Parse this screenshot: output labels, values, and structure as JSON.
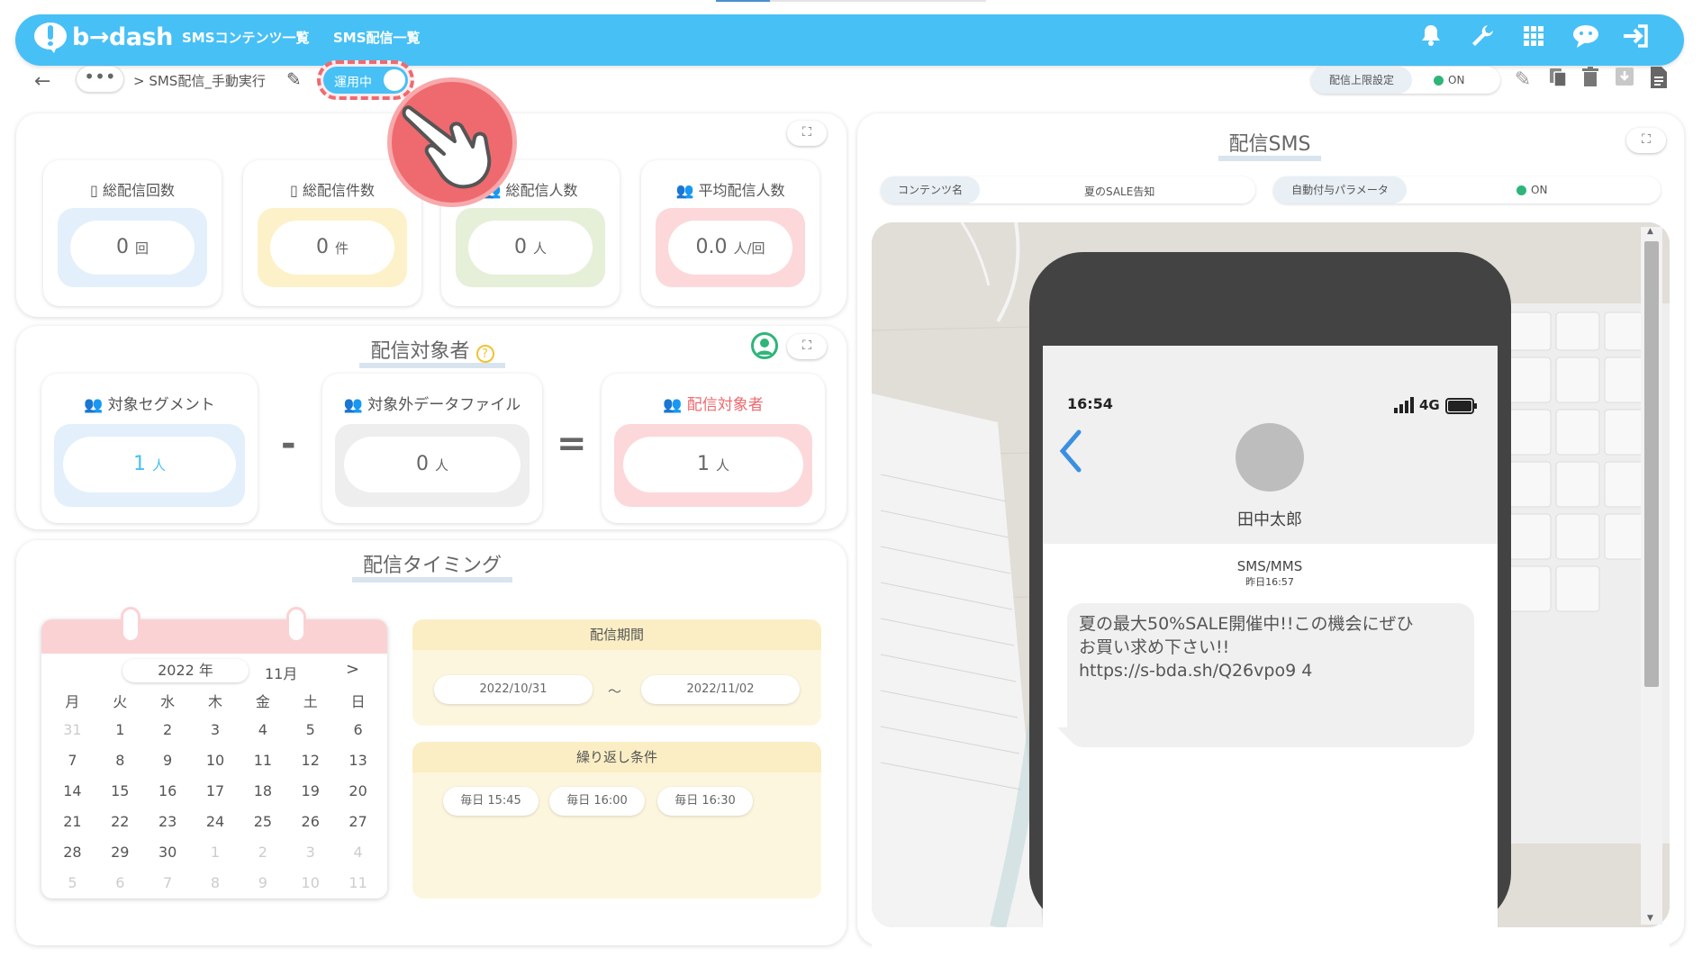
{
  "app": {
    "logo_text": "b→dash",
    "brand_color": "#47c0f6"
  },
  "nav": {
    "links": [
      "SMSコンテンツ一覧",
      "SMS配信一覧"
    ],
    "icons": [
      "bell-icon",
      "wrench-icon",
      "grid-icon",
      "chat-icon",
      "logout-icon"
    ]
  },
  "subbar": {
    "breadcrumb": "> SMS配信_手動実行",
    "dots": "•••",
    "status_toggle": "運用中",
    "limit_label": "配信上限設定",
    "limit_state": "ON",
    "toolbar_icons": [
      "edit-icon",
      "copy-icon",
      "trash-icon",
      "archive-icon",
      "document-icon"
    ]
  },
  "stats_panel": {
    "title": "配信",
    "cards": [
      {
        "label": "総配信回数",
        "value": "0",
        "unit": "回",
        "color": "#e3f0fb"
      },
      {
        "label": "総配信件数",
        "value": "0",
        "unit": "件",
        "color": "#fdf1c9"
      },
      {
        "label": "総配信人数",
        "value": "0",
        "unit": "人",
        "color": "#e6efd8"
      },
      {
        "label": "平均配信人数",
        "value": "0.0",
        "unit": "人/回",
        "color": "#fcd8da"
      }
    ]
  },
  "target_panel": {
    "title": "配信対象者",
    "help": "?",
    "segment": {
      "label": "対象セグメント",
      "value": "1",
      "unit": "人"
    },
    "excluded": {
      "label": "対象外データファイル",
      "value": "0",
      "unit": "人"
    },
    "result": {
      "label": "配信対象者",
      "value": "1",
      "unit": "人"
    },
    "minus": "-",
    "equals": "="
  },
  "timing_panel": {
    "title": "配信タイミング",
    "calendar": {
      "year": "2022 年",
      "month": "11月",
      "next": ">",
      "weekdays": [
        "月",
        "火",
        "水",
        "木",
        "金",
        "土",
        "日"
      ],
      "weeks": [
        [
          "31",
          "1",
          "2",
          "3",
          "4",
          "5",
          "6"
        ],
        [
          "7",
          "8",
          "9",
          "10",
          "11",
          "12",
          "13"
        ],
        [
          "14",
          "15",
          "16",
          "17",
          "18",
          "19",
          "20"
        ],
        [
          "21",
          "22",
          "23",
          "24",
          "25",
          "26",
          "27"
        ],
        [
          "28",
          "29",
          "30",
          "1",
          "2",
          "3",
          "4"
        ],
        [
          "5",
          "6",
          "7",
          "8",
          "9",
          "10",
          "11"
        ]
      ]
    },
    "period": {
      "title": "配信期間",
      "start": "2022/10/31",
      "separator": "～",
      "end": "2022/11/02"
    },
    "repeat": {
      "title": "繰り返し条件",
      "times": [
        "毎日 15:45",
        "毎日 16:00",
        "毎日 16:30"
      ]
    }
  },
  "sms_panel": {
    "title": "配信SMS",
    "content_label": "コンテンツ名",
    "content_value": "夏のSALE告知",
    "param_label": "自動付与パラメータ",
    "param_state": "ON",
    "phone": {
      "time": "16:54",
      "network": "4G",
      "contact": "田中太郎",
      "type": "SMS/MMS",
      "received": "昨日16:57",
      "message_lines": [
        "夏の最大50%SALE開催中!!この機会にぜひ",
        "お買い求め下さい!!",
        "https://s-bda.sh/Q26vpo9 4"
      ]
    }
  }
}
